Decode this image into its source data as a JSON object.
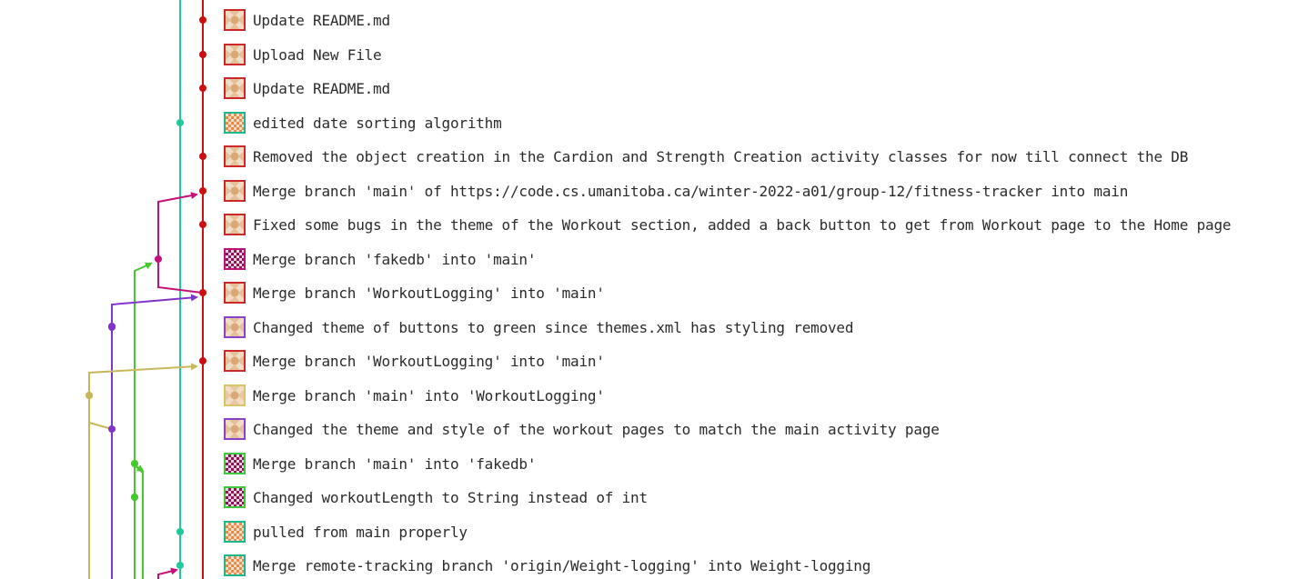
{
  "colors": {
    "red": "#cc0e0e",
    "teal": "#1fc99a",
    "magenta": "#c4127a",
    "purple": "#8034c9",
    "yellow": "#c9b85a",
    "green": "#44c92e"
  },
  "commits": [
    {
      "message": "Update README.md",
      "lane": "red",
      "avatar": "red"
    },
    {
      "message": "Upload New File",
      "lane": "red",
      "avatar": "red"
    },
    {
      "message": "Update README.md",
      "lane": "red",
      "avatar": "red"
    },
    {
      "message": "edited date sorting algorithm",
      "lane": "teal",
      "avatar": "teal"
    },
    {
      "message": "Removed the object creation in the Cardion and Strength Creation activity classes for now till connect the DB",
      "lane": "red",
      "avatar": "red"
    },
    {
      "message": "Merge branch 'main' of https://code.cs.umanitoba.ca/winter-2022-a01/group-12/fitness-tracker into main",
      "lane": "red",
      "avatar": "red"
    },
    {
      "message": "Fixed some bugs in the theme of the Workout section, added a back button to get from Workout page to the Home page",
      "lane": "red",
      "avatar": "red"
    },
    {
      "message": "Merge branch 'fakedb' into 'main'",
      "lane": "magenta",
      "avatar": "magenta"
    },
    {
      "message": "Merge branch 'WorkoutLogging' into 'main'",
      "lane": "red",
      "avatar": "red"
    },
    {
      "message": "Changed theme of buttons to green since themes.xml has styling removed",
      "lane": "purple",
      "avatar": "purple"
    },
    {
      "message": "Merge branch 'WorkoutLogging' into 'main'",
      "lane": "red",
      "avatar": "red"
    },
    {
      "message": "Merge branch 'main' into 'WorkoutLogging'",
      "lane": "yellow",
      "avatar": "yellow"
    },
    {
      "message": "Changed the theme and style of the workout pages to match the main activity page",
      "lane": "purple",
      "avatar": "purple"
    },
    {
      "message": "Merge branch 'main' into 'fakedb'",
      "lane": "green",
      "avatar": "green"
    },
    {
      "message": "Changed workoutLength to String instead of int",
      "lane": "green",
      "avatar": "green"
    },
    {
      "message": "pulled from main properly",
      "lane": "teal",
      "avatar": "teal"
    },
    {
      "message": "Merge remote-tracking branch 'origin/Weight-logging' into Weight-logging",
      "lane": "teal",
      "avatar": "teal"
    }
  ]
}
